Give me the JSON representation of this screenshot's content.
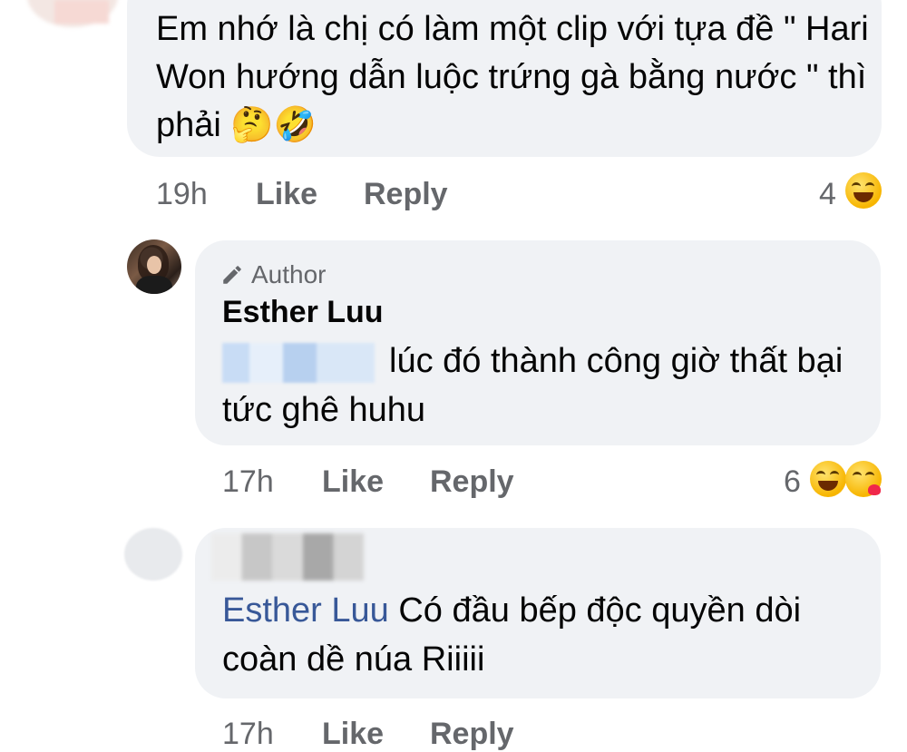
{
  "comments": [
    {
      "text": "Em nhớ là chị có làm một clip với tựa đề \" Hari Won hướng dẫn luộc trứng gà bằng nước \" thì phải",
      "emojis": "🤔🤣",
      "time": "19h",
      "like_label": "Like",
      "reply_label": "Reply",
      "reaction_count": "4"
    },
    {
      "badge": "Author",
      "author": "Esther Luu",
      "text": "lúc đó thành công giờ thất bại tức ghê huhu",
      "time": "17h",
      "like_label": "Like",
      "reply_label": "Reply",
      "reaction_count": "6"
    },
    {
      "mention": "Esther Luu",
      "text": "Có đầu bếp độc quyền dòi coàn dề núa Riiiii",
      "time": "17h",
      "like_label": "Like",
      "reply_label": "Reply"
    }
  ],
  "colors": {
    "bubble": "#f0f2f5",
    "meta": "#65676b",
    "mention": "#385898"
  }
}
